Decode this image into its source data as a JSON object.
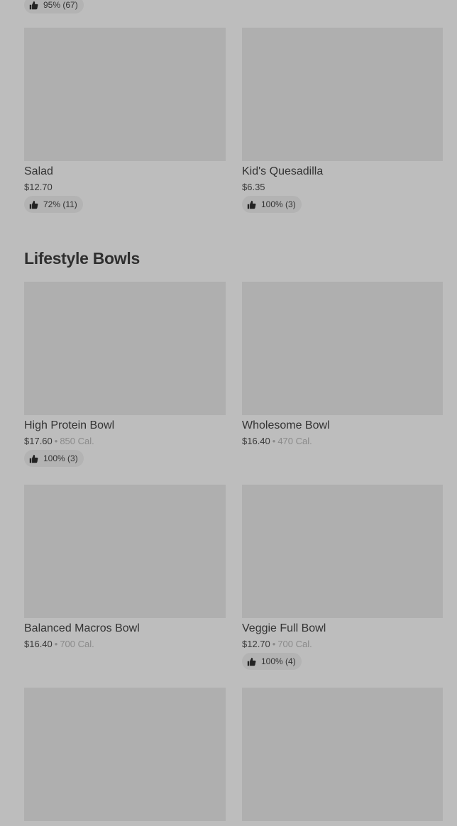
{
  "top_badge": {
    "rating": "95% (67)"
  },
  "sections": [
    {
      "items": [
        {
          "name": "Salad",
          "price": "$12.70",
          "rating": "72% (11)"
        },
        {
          "name": "Kid's Quesadilla",
          "price": "$6.35",
          "rating": "100% (3)"
        }
      ]
    },
    {
      "title": "Lifestyle Bowls",
      "items": [
        {
          "name": "High Protein Bowl",
          "price": "$17.60",
          "separator": "•",
          "calories": "850 Cal.",
          "rating": "100% (3)"
        },
        {
          "name": "Wholesome Bowl",
          "price": "$16.40",
          "separator": "•",
          "calories": "470 Cal."
        },
        {
          "name": "Balanced Macros Bowl",
          "price": "$16.40",
          "separator": "•",
          "calories": "700 Cal."
        },
        {
          "name": "Veggie Full Bowl",
          "price": "$12.70",
          "separator": "•",
          "calories": "700 Cal.",
          "rating": "100% (4)"
        }
      ]
    }
  ],
  "icons": {
    "rating": "thumbs-up-icon"
  },
  "colors": {
    "background": "#bdbdbd",
    "image_placeholder": "#afafaf",
    "badge": "#b3b3b3"
  }
}
